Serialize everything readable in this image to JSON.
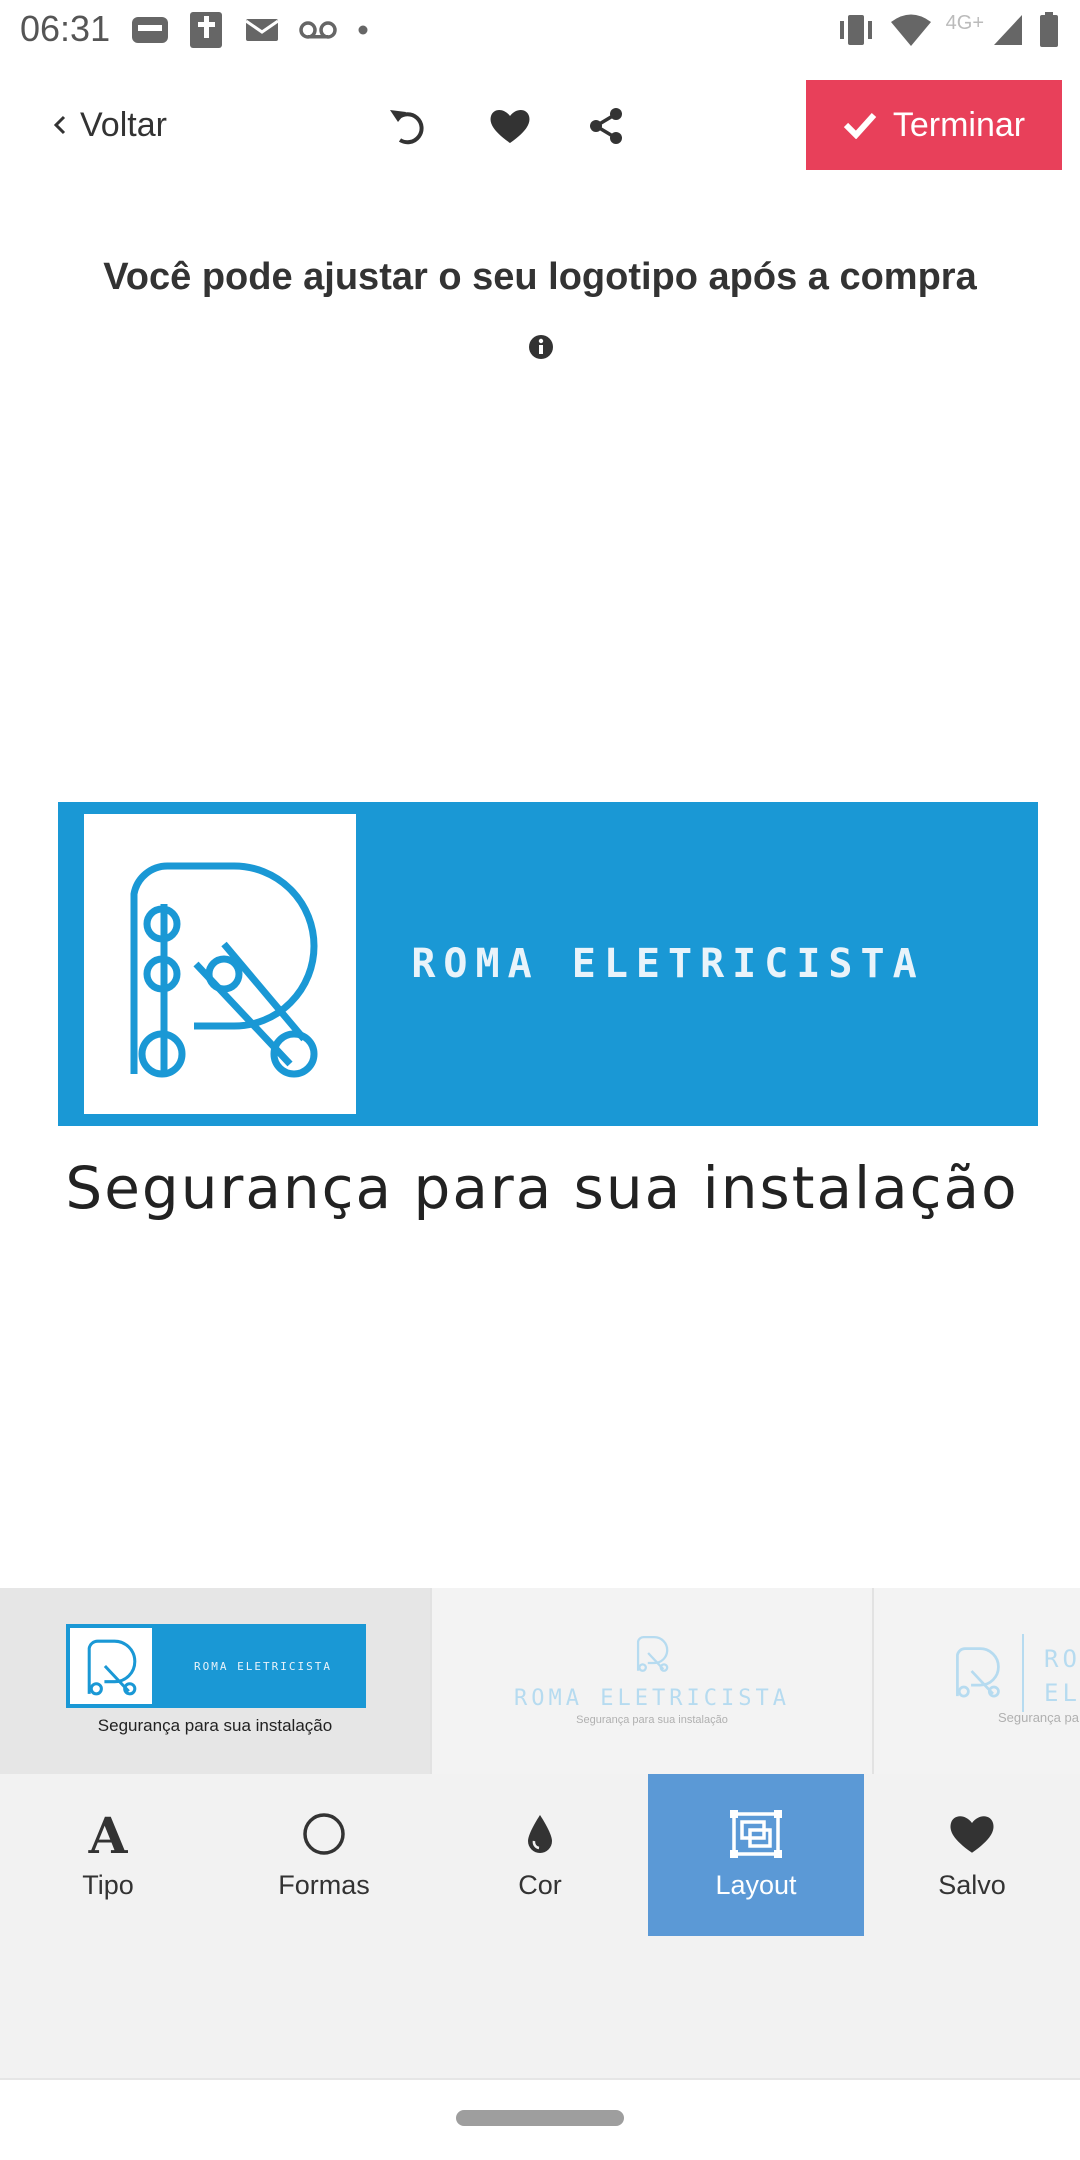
{
  "status_bar": {
    "time": "06:31",
    "network": "4G+"
  },
  "topbar": {
    "back_label": "Voltar",
    "finish_label": "Terminar",
    "icons": [
      "undo-icon",
      "heart-icon",
      "share-icon"
    ]
  },
  "headline": "Você pode ajustar o seu logotipo após a compra",
  "logo": {
    "name": "ROMA ELETRICISTA",
    "tagline": "Segurança para sua instalação",
    "brand_color": "#1a98d5"
  },
  "layouts": [
    {
      "name": "ROMA ELETRICISTA",
      "tagline": "Segurança para sua instalação"
    },
    {
      "name": "ROMA ELETRICISTA",
      "tagline": "Segurança para sua instalação"
    },
    {
      "name": "RO\nEL",
      "tagline": "Segurança pa"
    }
  ],
  "tabs": [
    {
      "label": "Tipo",
      "icon": "font-icon"
    },
    {
      "label": "Formas",
      "icon": "circle-icon"
    },
    {
      "label": "Cor",
      "icon": "drop-icon"
    },
    {
      "label": "Layout",
      "icon": "layout-icon",
      "active": true
    },
    {
      "label": "Salvo",
      "icon": "heart-icon"
    }
  ],
  "colors": {
    "accent": "#e8405a",
    "active_tab": "#5b99d6"
  }
}
